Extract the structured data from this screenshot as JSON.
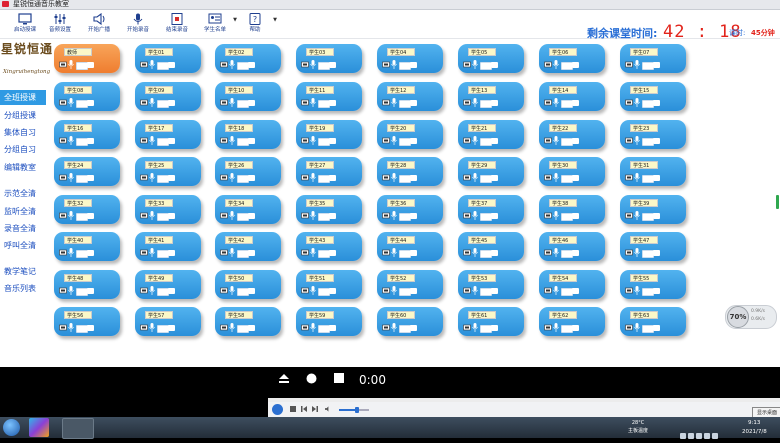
{
  "window": {
    "title": "星锐恒通音乐教室"
  },
  "toolbar": {
    "items": [
      {
        "label": "启动授课",
        "icon": "monitor-icon"
      },
      {
        "label": "音频设置",
        "icon": "sliders-icon"
      },
      {
        "label": "开始广播",
        "icon": "speaker-icon"
      },
      {
        "label": "开始录音",
        "icon": "microphone-icon"
      },
      {
        "label": "结束录音",
        "icon": "stop-record-icon"
      },
      {
        "label": "学生名单",
        "icon": "student-list-icon"
      },
      {
        "label": "帮助",
        "icon": "help-icon"
      }
    ],
    "remaining_label": "剩余课堂时间:",
    "timer": "42 : 18",
    "lesson_label": "课时:",
    "lesson_value": "45分钟"
  },
  "colors": {
    "accent": "#2f9ae3",
    "seat_blue": "#2a8fd9",
    "seat_teacher": "#ef7d2f",
    "timer_red": "#e2231a"
  },
  "sidebar": {
    "logo_cn": "星锐恒通",
    "logo_en": "Xingruihengtong",
    "items": [
      {
        "label": "全班授课",
        "active": true
      },
      {
        "label": "分组授课",
        "active": false
      },
      {
        "label": "集体自习",
        "active": false
      },
      {
        "label": "分组自习",
        "active": false
      },
      {
        "label": "编辑教室",
        "active": false
      },
      {
        "label": "示范全清",
        "active": false
      },
      {
        "label": "监听全清",
        "active": false
      },
      {
        "label": "录音全清",
        "active": false
      },
      {
        "label": "呼叫全清",
        "active": false
      },
      {
        "label": "教学笔记",
        "active": false
      },
      {
        "label": "音乐列表",
        "active": false
      }
    ]
  },
  "seats": [
    "教师",
    "学生01",
    "学生02",
    "学生03",
    "学生04",
    "学生05",
    "学生06",
    "学生07",
    "学生08",
    "学生09",
    "学生10",
    "学生11",
    "学生12",
    "学生13",
    "学生14",
    "学生15",
    "学生16",
    "学生17",
    "学生18",
    "学生19",
    "学生20",
    "学生21",
    "学生22",
    "学生23",
    "学生24",
    "学生25",
    "学生26",
    "学生27",
    "学生28",
    "学生29",
    "学生30",
    "学生31",
    "学生32",
    "学生33",
    "学生34",
    "学生35",
    "学生36",
    "学生37",
    "学生38",
    "学生39",
    "学生40",
    "学生41",
    "学生42",
    "学生43",
    "学生44",
    "学生45",
    "学生46",
    "学生47",
    "学生48",
    "学生49",
    "学生50",
    "学生51",
    "学生52",
    "学生53",
    "学生54",
    "学生55",
    "学生56",
    "学生57",
    "学生58",
    "学生59",
    "学生60",
    "学生61",
    "学生62",
    "学生63"
  ],
  "gauge": {
    "percent": "70%",
    "line1": "0.9K/s",
    "line2": "0.6K/s"
  },
  "player": {
    "time": "0:00",
    "volume": 0.6
  },
  "desktop_button": "显示桌面",
  "taskbar": {
    "weather_temp": "28°C",
    "weather_desc": "主板温度",
    "time": "9:13",
    "date": "2021/7/8"
  }
}
